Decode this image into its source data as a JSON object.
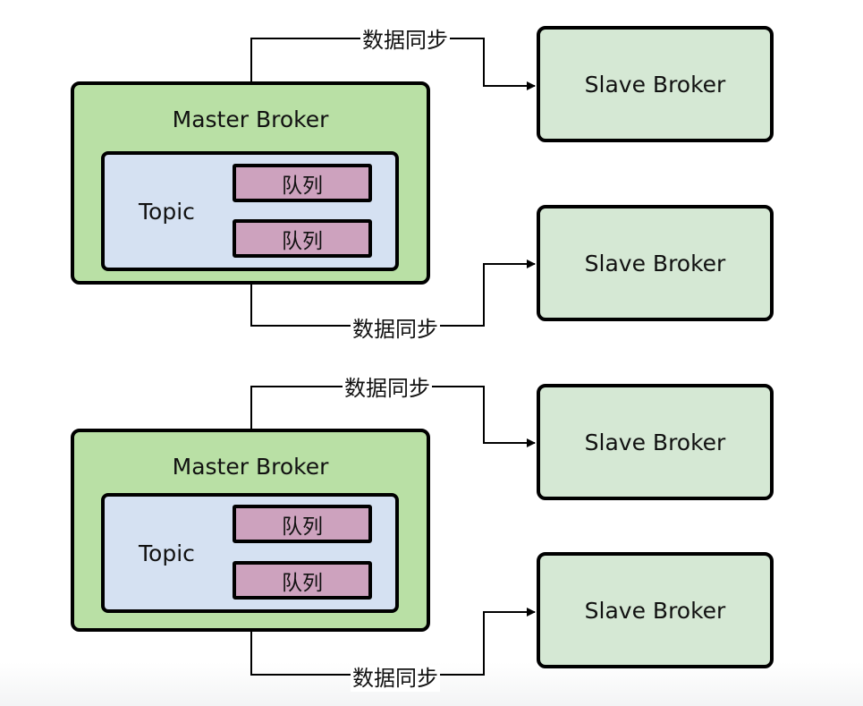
{
  "groups": [
    {
      "master": {
        "title": "Master Broker",
        "topic": "Topic",
        "queues": [
          "队列",
          "队列"
        ]
      },
      "sync_top": "数据同步",
      "sync_bottom": "数据同步",
      "slaves": [
        "Slave Broker",
        "Slave Broker"
      ]
    },
    {
      "master": {
        "title": "Master Broker",
        "topic": "Topic",
        "queues": [
          "队列",
          "队列"
        ]
      },
      "sync_top": "数据同步",
      "sync_bottom": "数据同步",
      "slaves": [
        "Slave Broker",
        "Slave Broker"
      ]
    }
  ],
  "colors": {
    "master_fill": "#b9e0a5",
    "topic_fill": "#d5e1f2",
    "queue_fill": "#cda2be",
    "slave_fill": "#d5e8d4",
    "stroke": "#000000"
  }
}
